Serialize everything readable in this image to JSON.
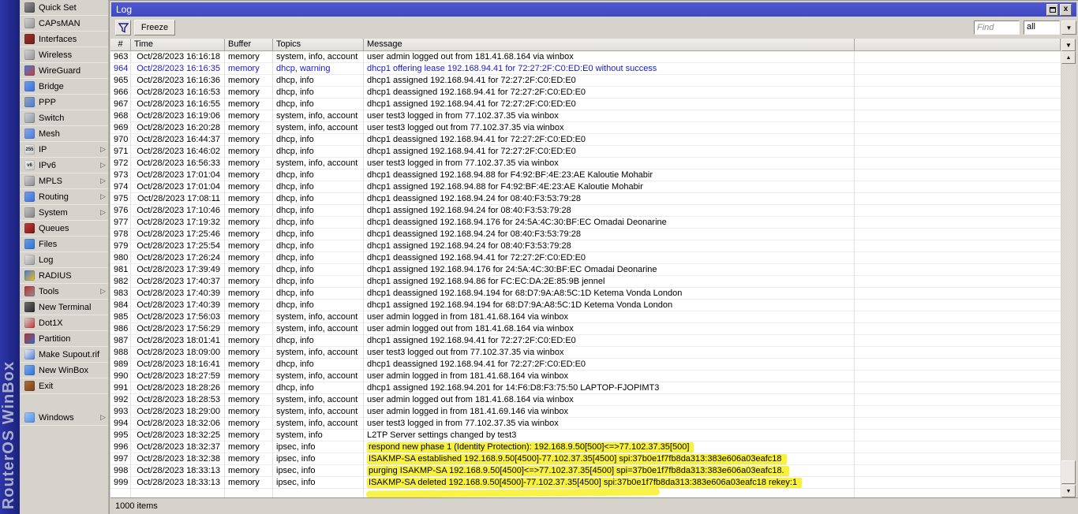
{
  "brand": {
    "vertical_text": "RouterOS WinBox"
  },
  "sidebar": {
    "items": [
      {
        "id": "quick-set",
        "label": "Quick Set",
        "submenu": false,
        "icon": {
          "c1": "#9a9a9a",
          "c2": "#4a4a4a",
          "char": ""
        }
      },
      {
        "id": "capsman",
        "label": "CAPsMAN",
        "submenu": false,
        "icon": {
          "c1": "#d8d8d8",
          "c2": "#8f8f8f",
          "char": ""
        }
      },
      {
        "id": "interfaces",
        "label": "Interfaces",
        "submenu": false,
        "icon": {
          "c1": "#9b352b",
          "c2": "#6c211a",
          "char": ""
        }
      },
      {
        "id": "wireless",
        "label": "Wireless",
        "submenu": false,
        "icon": {
          "c1": "#d8d8d8",
          "c2": "#8f8f8f",
          "char": ""
        }
      },
      {
        "id": "wireguard",
        "label": "WireGuard",
        "submenu": false,
        "icon": {
          "c1": "#4a79d8",
          "c2": "#c04040",
          "char": ""
        }
      },
      {
        "id": "bridge",
        "label": "Bridge",
        "submenu": false,
        "icon": {
          "c1": "#6f9fe8",
          "c2": "#3a6fd8",
          "char": ""
        }
      },
      {
        "id": "ppp",
        "label": "PPP",
        "submenu": false,
        "icon": {
          "c1": "#9aa4b8",
          "c2": "#4a79d8",
          "char": ""
        }
      },
      {
        "id": "switch",
        "label": "Switch",
        "submenu": false,
        "icon": {
          "c1": "#d0d4d8",
          "c2": "#8a949e",
          "char": ""
        }
      },
      {
        "id": "mesh",
        "label": "Mesh",
        "submenu": false,
        "icon": {
          "c1": "#88aae8",
          "c2": "#4a79d8",
          "char": ""
        }
      },
      {
        "id": "ip",
        "label": "IP",
        "submenu": true,
        "icon": {
          "c1": "#f0f0f0",
          "c2": "#c8c8c8",
          "char": "255"
        }
      },
      {
        "id": "ipv6",
        "label": "IPv6",
        "submenu": true,
        "icon": {
          "c1": "#f0f0f0",
          "c2": "#c8c8c8",
          "char": "v6"
        }
      },
      {
        "id": "mpls",
        "label": "MPLS",
        "submenu": true,
        "icon": {
          "c1": "#d8d8d8",
          "c2": "#888888",
          "char": ""
        }
      },
      {
        "id": "routing",
        "label": "Routing",
        "submenu": true,
        "icon": {
          "c1": "#7aa0e8",
          "c2": "#3a6fd8",
          "char": ""
        }
      },
      {
        "id": "system",
        "label": "System",
        "submenu": true,
        "icon": {
          "c1": "#c8c8c8",
          "c2": "#808080",
          "char": ""
        }
      },
      {
        "id": "queues",
        "label": "Queues",
        "submenu": false,
        "icon": {
          "c1": "#c04040",
          "c2": "#7a1515",
          "char": ""
        }
      },
      {
        "id": "files",
        "label": "Files",
        "submenu": false,
        "icon": {
          "c1": "#6aa0e8",
          "c2": "#2f6fd0",
          "char": ""
        }
      },
      {
        "id": "log",
        "label": "Log",
        "submenu": false,
        "icon": {
          "c1": "#e8e8e8",
          "c2": "#9a9a9a",
          "char": ""
        }
      },
      {
        "id": "radius",
        "label": "RADIUS",
        "submenu": false,
        "icon": {
          "c1": "#4a79d8",
          "c2": "#e8c020",
          "char": ""
        }
      },
      {
        "id": "tools",
        "label": "Tools",
        "submenu": true,
        "icon": {
          "c1": "#c03030",
          "c2": "#909090",
          "char": ""
        }
      },
      {
        "id": "new-terminal",
        "label": "New Terminal",
        "submenu": false,
        "icon": {
          "c1": "#707070",
          "c2": "#262626",
          "char": ""
        }
      },
      {
        "id": "dot1x",
        "label": "Dot1X",
        "submenu": false,
        "icon": {
          "c1": "#d8d8d8",
          "c2": "#c03030",
          "char": ""
        }
      },
      {
        "id": "partition",
        "label": "Partition",
        "submenu": false,
        "icon": {
          "c1": "#c03030",
          "c2": "#3070c0",
          "char": ""
        }
      },
      {
        "id": "make-supout-rif",
        "label": "Make Supout.rif",
        "submenu": false,
        "icon": {
          "c1": "#f4f4f4",
          "c2": "#4a79d8",
          "char": ""
        }
      },
      {
        "id": "new-winbox",
        "label": "New WinBox",
        "submenu": false,
        "icon": {
          "c1": "#7ab0f0",
          "c2": "#2f6fd0",
          "char": ""
        }
      },
      {
        "id": "exit",
        "label": "Exit",
        "submenu": false,
        "icon": {
          "c1": "#b07040",
          "c2": "#7a4018",
          "char": ""
        }
      },
      {
        "gap": true
      },
      {
        "id": "windows",
        "label": "Windows",
        "submenu": true,
        "icon": {
          "c1": "#a8c8f0",
          "c2": "#4a90e8",
          "char": ""
        }
      }
    ]
  },
  "window": {
    "title": "Log",
    "restore_button": "restore",
    "close_button": "close"
  },
  "toolbar": {
    "freeze_label": "Freeze",
    "find_placeholder": "Find",
    "scope_value": "all"
  },
  "table": {
    "columns": [
      "#",
      "Time",
      "Buffer",
      "Topics",
      "Message"
    ],
    "rows": [
      {
        "id": "963",
        "time": "Oct/28/2023 16:16:18",
        "buffer": "memory",
        "topics": "system, info, account",
        "message": "user admin logged out from 181.41.68.164 via winbox",
        "style": "normal"
      },
      {
        "id": "964",
        "time": "Oct/28/2023 16:16:35",
        "buffer": "memory",
        "topics": "dhcp, warning",
        "message": "dhcp1 offering lease 192.168.94.41 for 72:27:2F:C0:ED:E0 without success",
        "style": "warning"
      },
      {
        "id": "965",
        "time": "Oct/28/2023 16:16:36",
        "buffer": "memory",
        "topics": "dhcp, info",
        "message": "dhcp1 assigned 192.168.94.41 for 72:27:2F:C0:ED:E0",
        "style": "normal"
      },
      {
        "id": "966",
        "time": "Oct/28/2023 16:16:53",
        "buffer": "memory",
        "topics": "dhcp, info",
        "message": "dhcp1 deassigned 192.168.94.41 for 72:27:2F:C0:ED:E0",
        "style": "normal"
      },
      {
        "id": "967",
        "time": "Oct/28/2023 16:16:55",
        "buffer": "memory",
        "topics": "dhcp, info",
        "message": "dhcp1 assigned 192.168.94.41 for 72:27:2F:C0:ED:E0",
        "style": "normal"
      },
      {
        "id": "968",
        "time": "Oct/28/2023 16:19:06",
        "buffer": "memory",
        "topics": "system, info, account",
        "message": "user test3 logged in from 77.102.37.35 via winbox",
        "style": "normal"
      },
      {
        "id": "969",
        "time": "Oct/28/2023 16:20:28",
        "buffer": "memory",
        "topics": "system, info, account",
        "message": "user test3 logged out from 77.102.37.35 via winbox",
        "style": "normal"
      },
      {
        "id": "970",
        "time": "Oct/28/2023 16:44:37",
        "buffer": "memory",
        "topics": "dhcp, info",
        "message": "dhcp1 deassigned 192.168.94.41 for 72:27:2F:C0:ED:E0",
        "style": "normal"
      },
      {
        "id": "971",
        "time": "Oct/28/2023 16:46:02",
        "buffer": "memory",
        "topics": "dhcp, info",
        "message": "dhcp1 assigned 192.168.94.41 for 72:27:2F:C0:ED:E0",
        "style": "normal"
      },
      {
        "id": "972",
        "time": "Oct/28/2023 16:56:33",
        "buffer": "memory",
        "topics": "system, info, account",
        "message": "user test3 logged in from 77.102.37.35 via winbox",
        "style": "normal"
      },
      {
        "id": "973",
        "time": "Oct/28/2023 17:01:04",
        "buffer": "memory",
        "topics": "dhcp, info",
        "message": "dhcp1 deassigned 192.168.94.88 for F4:92:BF:4E:23:AE Kaloutie Mohabir",
        "style": "normal"
      },
      {
        "id": "974",
        "time": "Oct/28/2023 17:01:04",
        "buffer": "memory",
        "topics": "dhcp, info",
        "message": "dhcp1 assigned 192.168.94.88 for F4:92:BF:4E:23:AE Kaloutie Mohabir",
        "style": "normal"
      },
      {
        "id": "975",
        "time": "Oct/28/2023 17:08:11",
        "buffer": "memory",
        "topics": "dhcp, info",
        "message": "dhcp1 deassigned 192.168.94.24 for 08:40:F3:53:79:28",
        "style": "normal"
      },
      {
        "id": "976",
        "time": "Oct/28/2023 17:10:46",
        "buffer": "memory",
        "topics": "dhcp, info",
        "message": "dhcp1 assigned 192.168.94.24 for 08:40:F3:53:79:28",
        "style": "normal"
      },
      {
        "id": "977",
        "time": "Oct/28/2023 17:19:32",
        "buffer": "memory",
        "topics": "dhcp, info",
        "message": "dhcp1 deassigned 192.168.94.176 for 24:5A:4C:30:BF:EC Omadai Deonarine",
        "style": "normal"
      },
      {
        "id": "978",
        "time": "Oct/28/2023 17:25:46",
        "buffer": "memory",
        "topics": "dhcp, info",
        "message": "dhcp1 deassigned 192.168.94.24 for 08:40:F3:53:79:28",
        "style": "normal"
      },
      {
        "id": "979",
        "time": "Oct/28/2023 17:25:54",
        "buffer": "memory",
        "topics": "dhcp, info",
        "message": "dhcp1 assigned 192.168.94.24 for 08:40:F3:53:79:28",
        "style": "normal"
      },
      {
        "id": "980",
        "time": "Oct/28/2023 17:26:24",
        "buffer": "memory",
        "topics": "dhcp, info",
        "message": "dhcp1 deassigned 192.168.94.41 for 72:27:2F:C0:ED:E0",
        "style": "normal"
      },
      {
        "id": "981",
        "time": "Oct/28/2023 17:39:49",
        "buffer": "memory",
        "topics": "dhcp, info",
        "message": "dhcp1 assigned 192.168.94.176 for 24:5A:4C:30:BF:EC Omadai Deonarine",
        "style": "normal"
      },
      {
        "id": "982",
        "time": "Oct/28/2023 17:40:37",
        "buffer": "memory",
        "topics": "dhcp, info",
        "message": "dhcp1 assigned 192.168.94.86 for FC:EC:DA:2E:85:9B jennel",
        "style": "normal"
      },
      {
        "id": "983",
        "time": "Oct/28/2023 17:40:39",
        "buffer": "memory",
        "topics": "dhcp, info",
        "message": "dhcp1 deassigned 192.168.94.194 for 68:D7:9A:A8:5C:1D Ketema Vonda London",
        "style": "normal"
      },
      {
        "id": "984",
        "time": "Oct/28/2023 17:40:39",
        "buffer": "memory",
        "topics": "dhcp, info",
        "message": "dhcp1 assigned 192.168.94.194 for 68:D7:9A:A8:5C:1D Ketema Vonda London",
        "style": "normal"
      },
      {
        "id": "985",
        "time": "Oct/28/2023 17:56:03",
        "buffer": "memory",
        "topics": "system, info, account",
        "message": "user admin logged in from 181.41.68.164 via winbox",
        "style": "normal"
      },
      {
        "id": "986",
        "time": "Oct/28/2023 17:56:29",
        "buffer": "memory",
        "topics": "system, info, account",
        "message": "user admin logged out from 181.41.68.164 via winbox",
        "style": "normal"
      },
      {
        "id": "987",
        "time": "Oct/28/2023 18:01:41",
        "buffer": "memory",
        "topics": "dhcp, info",
        "message": "dhcp1 assigned 192.168.94.41 for 72:27:2F:C0:ED:E0",
        "style": "normal"
      },
      {
        "id": "988",
        "time": "Oct/28/2023 18:09:00",
        "buffer": "memory",
        "topics": "system, info, account",
        "message": "user test3 logged out from 77.102.37.35 via winbox",
        "style": "normal"
      },
      {
        "id": "989",
        "time": "Oct/28/2023 18:16:41",
        "buffer": "memory",
        "topics": "dhcp, info",
        "message": "dhcp1 deassigned 192.168.94.41 for 72:27:2F:C0:ED:E0",
        "style": "normal"
      },
      {
        "id": "990",
        "time": "Oct/28/2023 18:27:59",
        "buffer": "memory",
        "topics": "system, info, account",
        "message": "user admin logged in from 181.41.68.164 via winbox",
        "style": "normal"
      },
      {
        "id": "991",
        "time": "Oct/28/2023 18:28:26",
        "buffer": "memory",
        "topics": "dhcp, info",
        "message": "dhcp1 assigned 192.168.94.201 for 14:F6:D8:F3:75:50 LAPTOP-FJOPIMT3",
        "style": "normal"
      },
      {
        "id": "992",
        "time": "Oct/28/2023 18:28:53",
        "buffer": "memory",
        "topics": "system, info, account",
        "message": "user admin logged out from 181.41.68.164 via winbox",
        "style": "normal"
      },
      {
        "id": "993",
        "time": "Oct/28/2023 18:29:00",
        "buffer": "memory",
        "topics": "system, info, account",
        "message": "user admin logged in from 181.41.69.146 via winbox",
        "style": "normal"
      },
      {
        "id": "994",
        "time": "Oct/28/2023 18:32:06",
        "buffer": "memory",
        "topics": "system, info, account",
        "message": "user test3 logged in from 77.102.37.35 via winbox",
        "style": "normal"
      },
      {
        "id": "995",
        "time": "Oct/28/2023 18:32:25",
        "buffer": "memory",
        "topics": "system, info",
        "message": "L2TP Server settings changed by test3",
        "style": "normal"
      },
      {
        "id": "996",
        "time": "Oct/28/2023 18:32:37",
        "buffer": "memory",
        "topics": "ipsec, info",
        "message": "respond new phase 1 (Identity Protection): 192.168.9.50[500]<=>77.102.37.35[500]",
        "style": "highlight"
      },
      {
        "id": "997",
        "time": "Oct/28/2023 18:32:38",
        "buffer": "memory",
        "topics": "ipsec, info",
        "message": "ISAKMP-SA established 192.168.9.50[4500]-77.102.37.35[4500] spi:37b0e1f7fb8da313:383e606a03eafc18",
        "style": "highlight"
      },
      {
        "id": "998",
        "time": "Oct/28/2023 18:33:13",
        "buffer": "memory",
        "topics": "ipsec, info",
        "message": "purging ISAKMP-SA 192.168.9.50[4500]<=>77.102.37.35[4500] spi=37b0e1f7fb8da313:383e606a03eafc18.",
        "style": "highlight"
      },
      {
        "id": "999",
        "time": "Oct/28/2023 18:33:13",
        "buffer": "memory",
        "topics": "ipsec, info",
        "message": "ISAKMP-SA deleted 192.168.9.50[4500]-77.102.37.35[4500] spi:37b0e1f7fb8da313:383e606a03eafc18 rekey:1",
        "style": "highlight"
      }
    ]
  },
  "status_bar": {
    "items_count": "1000 items"
  },
  "colors": {
    "titlebar_blue": "#4850c8",
    "warning_text_blue": "#1818cf",
    "highlight_yellow": "#f8f23a",
    "brand_strip_blue": "#222a90"
  }
}
